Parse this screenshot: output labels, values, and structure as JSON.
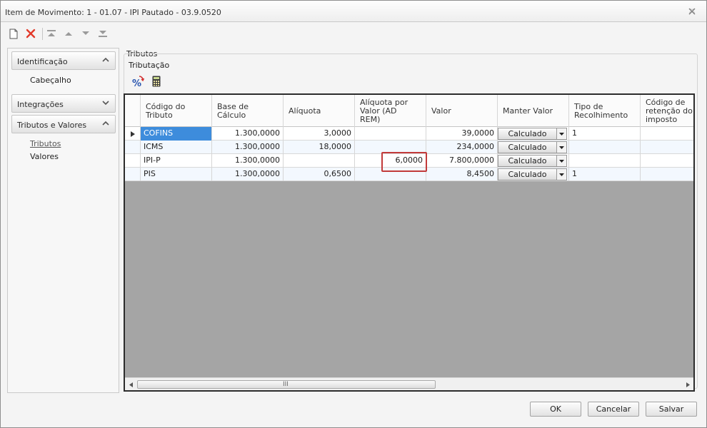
{
  "window": {
    "title": "Item de Movimento: 1 - 01.07 - IPI Pautado - 03.9.0520"
  },
  "toolbar": {
    "icons": [
      "new-icon",
      "delete-icon",
      "first-icon",
      "prev-icon",
      "next-icon",
      "last-icon"
    ]
  },
  "sidebar": {
    "groups": [
      {
        "label": "Identificação",
        "expanded": true,
        "items": [
          "Cabeçalho"
        ]
      },
      {
        "label": "Integrações",
        "expanded": false,
        "items": []
      },
      {
        "label": "Tributos e Valores",
        "expanded": true,
        "items": [
          "Tributos",
          "Valores"
        ],
        "active_item": "Tributos"
      }
    ]
  },
  "content": {
    "section_title": "Tributos",
    "group_title": "Tributação"
  },
  "grid": {
    "columns": [
      "Código do\nTributo",
      "Base de\nCálculo",
      "Alíquota",
      "Alíquota por\nValor (AD\nREM)",
      "Valor",
      "Manter Valor",
      "Tipo de\nRecolhimento",
      "Código de\nretenção do\nimposto"
    ],
    "rows": [
      {
        "codigo": "COFINS",
        "base": "1.300,0000",
        "aliquota": "3,0000",
        "aliq_valor": "",
        "valor": "39,0000",
        "manter": "Calculado",
        "tipo": "1",
        "codret": ""
      },
      {
        "codigo": "ICMS",
        "base": "1.300,0000",
        "aliquota": "18,0000",
        "aliq_valor": "",
        "valor": "234,0000",
        "manter": "Calculado",
        "tipo": "",
        "codret": ""
      },
      {
        "codigo": "IPI-P",
        "base": "1.300,0000",
        "aliquota": "",
        "aliq_valor": "6,0000",
        "valor": "7.800,0000",
        "manter": "Calculado",
        "tipo": "",
        "codret": ""
      },
      {
        "codigo": "PIS",
        "base": "1.300,0000",
        "aliquota": "0,6500",
        "aliq_valor": "",
        "valor": "8,4500",
        "manter": "Calculado",
        "tipo": "1",
        "codret": ""
      }
    ],
    "scrollbar_grip": "III"
  },
  "footer": {
    "ok": "OK",
    "cancel": "Cancelar",
    "save": "Salvar"
  },
  "colors": {
    "selection": "#3d8cdc",
    "highlight": "#c23a3a",
    "grid_empty": "#a5a5a5"
  }
}
